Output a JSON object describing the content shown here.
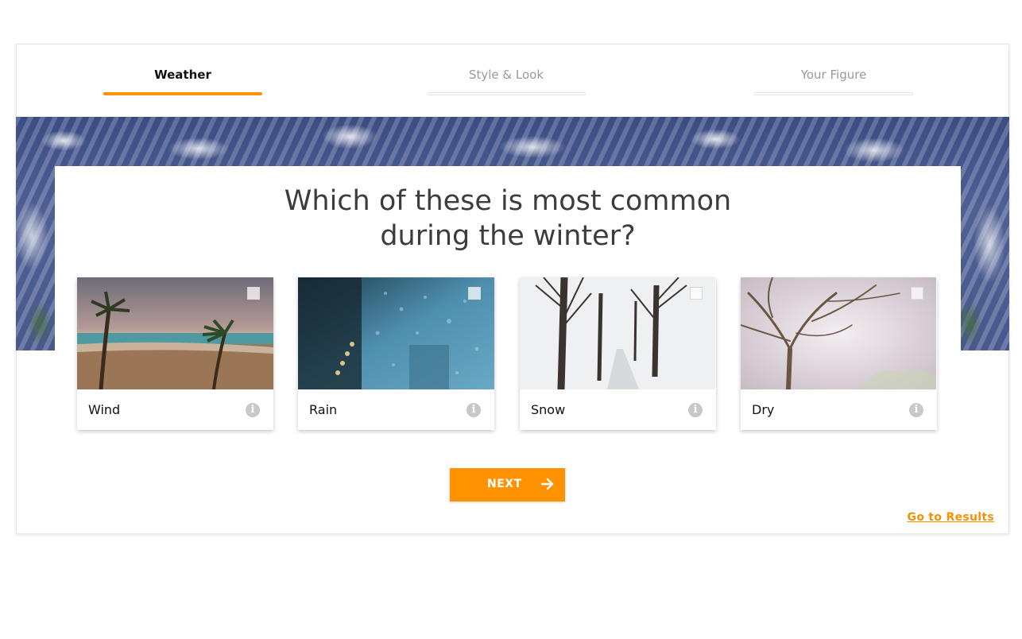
{
  "steps": [
    {
      "label": "Weather",
      "active": true
    },
    {
      "label": "Style & Look",
      "active": false
    },
    {
      "label": "Your Figure",
      "active": false
    }
  ],
  "question": {
    "line1": "Which of these is most common",
    "line2": "during the winter?"
  },
  "options": [
    {
      "label": "Wind",
      "image": "palm trees on beach"
    },
    {
      "label": "Rain",
      "image": "raindrops on window"
    },
    {
      "label": "Snow",
      "image": "snowy tree-lined road"
    },
    {
      "label": "Dry",
      "image": "bare tree"
    }
  ],
  "next_button": {
    "label": "NEXT",
    "icon": "arrow-right-icon"
  },
  "results_link": {
    "label": "Go to Results"
  },
  "colors": {
    "accent": "#ff9200",
    "link": "#f59000",
    "question_text": "#3c3c3c",
    "inactive_step": "#9a9a9a"
  }
}
